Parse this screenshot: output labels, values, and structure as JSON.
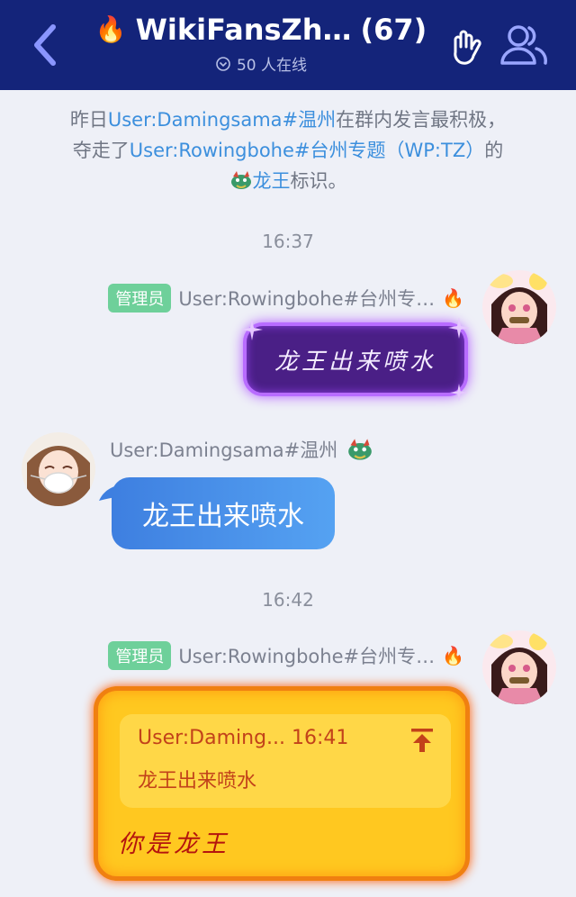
{
  "header": {
    "back_icon": "chevron-left-icon",
    "fire_icon": "🔥",
    "title": "WikiFansZh…",
    "member_count": "(67)",
    "online_text": "50 人在线",
    "right_icons": [
      "hand-gesture-icon",
      "members-icon"
    ]
  },
  "notice": {
    "line1_prefix": "昨日",
    "line1_user": "User:Damingsama#温州",
    "line1_suffix": "在群内发言最积极，",
    "line2_prefix": "夺走了",
    "line2_user": "User:Rowingbohe#台州专题（WP:TZ）",
    "line2_suffix": "的",
    "line3_title": "龙王",
    "line3_suffix": "标识。"
  },
  "messages": [
    {
      "time": "16:37",
      "badge": "管理员",
      "sender": "User:Rowingbohe#台州专…",
      "sender_icon": "🔥",
      "text": "龙王出来喷水"
    },
    {
      "sender": "User:Damingsama#温州",
      "text": "龙王出来喷水"
    },
    {
      "time": "16:42",
      "badge": "管理员",
      "sender": "User:Rowingbohe#台州专…",
      "sender_icon": "🔥",
      "reply_meta": "User:Daming... 16:41",
      "reply_text": "龙王出来喷水",
      "text": "你是龙王"
    }
  ],
  "colors": {
    "header_bg": "#14247a",
    "link": "#3c8fdd",
    "admin_badge": "#6ed09a",
    "bubble_blue": "#4a90e8",
    "bubble_purple": "#4a1f86",
    "bubble_gold": "#ffc820"
  }
}
